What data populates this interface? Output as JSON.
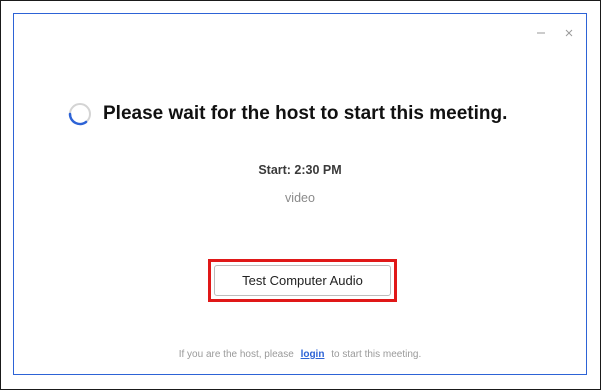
{
  "window": {
    "minimize_icon": "minimize-icon",
    "close_icon": "close-icon"
  },
  "main": {
    "spinner_icon": "loading-spinner-icon",
    "heading": "Please wait for the host to start this meeting.",
    "start_time": "Start: 2:30 PM",
    "subtitle": "video",
    "test_audio_label": "Test Computer Audio"
  },
  "footer": {
    "prefix": "If you are the host, please",
    "login_link": "login",
    "suffix": "to start this meeting."
  },
  "colors": {
    "accent": "#2d63d6",
    "highlight": "#e01818"
  }
}
